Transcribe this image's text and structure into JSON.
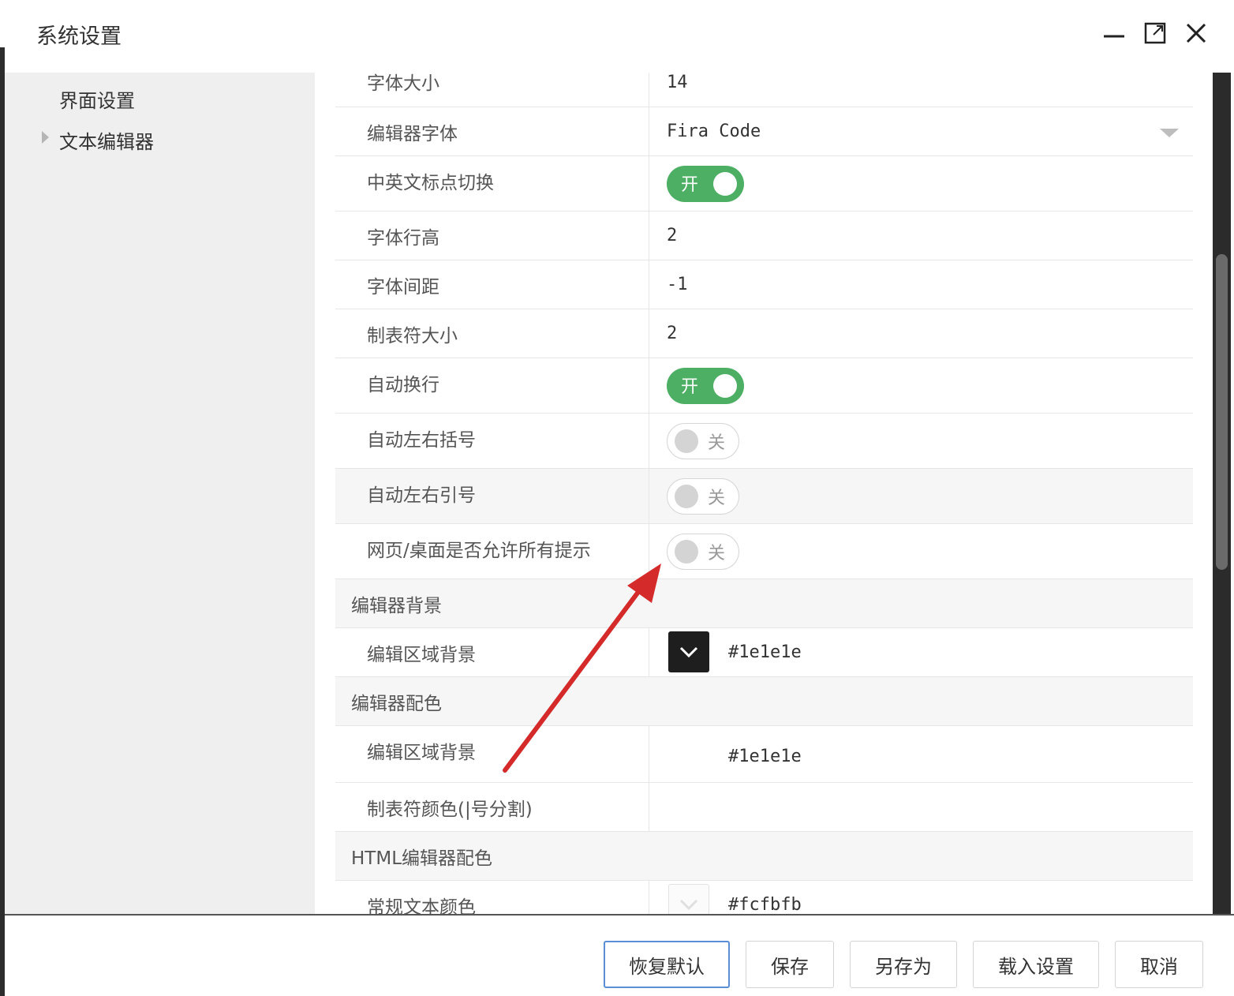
{
  "window": {
    "title": "系统设置",
    "minimize_icon": "minimize-icon",
    "maximize_icon": "maximize-icon",
    "close_icon": "close-icon"
  },
  "sidebar": {
    "items": [
      {
        "label": "界面设置",
        "expandable": false
      },
      {
        "label": "文本编辑器",
        "expandable": true
      }
    ]
  },
  "settings": {
    "font_size": {
      "label": "字体大小",
      "value": "14"
    },
    "editor_font": {
      "label": "编辑器字体",
      "value": "Fira Code"
    },
    "punct_switch": {
      "label": "中英文标点切换",
      "state": "开"
    },
    "line_height": {
      "label": "字体行高",
      "value": "2"
    },
    "letter_spacing": {
      "label": "字体间距",
      "value": "-1"
    },
    "tab_size": {
      "label": "制表符大小",
      "value": "2"
    },
    "word_wrap": {
      "label": "自动换行",
      "state": "开"
    },
    "auto_brackets": {
      "label": "自动左右括号",
      "state": "关"
    },
    "auto_quotes": {
      "label": "自动左右引号",
      "state": "关"
    },
    "allow_hints": {
      "label": "网页/桌面是否允许所有提示",
      "state": "关"
    }
  },
  "groups": {
    "editor_bg": {
      "title": "编辑器背景",
      "area_bg": {
        "label": "编辑区域背景",
        "value": "#1e1e1e"
      }
    },
    "editor_colors": {
      "title": "编辑器配色",
      "area_bg": {
        "label": "编辑区域背景",
        "value": "#1e1e1e"
      },
      "tab_color": {
        "label": "制表符颜色(|号分割)",
        "value": ""
      }
    },
    "html_colors": {
      "title": "HTML编辑器配色",
      "text_color": {
        "label": "常规文本颜色",
        "value": "#fcfbfb"
      }
    }
  },
  "footer": {
    "restore_default": "恢复默认",
    "save": "保存",
    "save_as": "另存为",
    "load_settings": "载入设置",
    "cancel": "取消"
  },
  "colors": {
    "toggle_on": "#4caf63",
    "annotation_arrow": "#d42a2a",
    "primary_border": "#5b8ed4"
  }
}
